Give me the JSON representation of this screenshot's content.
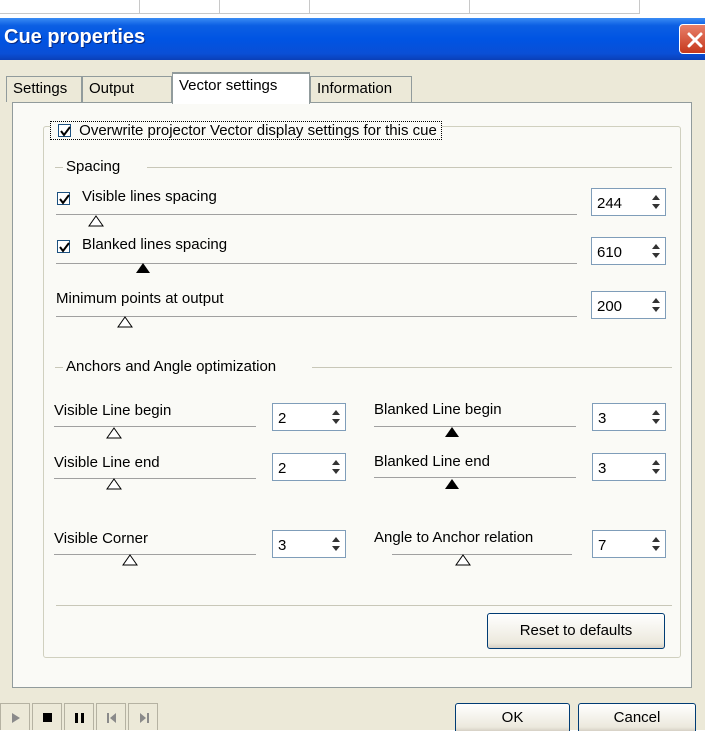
{
  "window": {
    "title": "Cue properties"
  },
  "tabs": [
    {
      "label": "Settings",
      "active": false
    },
    {
      "label": "Output",
      "active": false
    },
    {
      "label": "Vector settings",
      "active": true
    },
    {
      "label": "Information",
      "active": false
    }
  ],
  "overwrite": {
    "label": "Overwrite projector Vector display settings for this cue",
    "checked": true
  },
  "spacing": {
    "section_label": "Spacing",
    "visible_lines": {
      "label": "Visible lines spacing",
      "checked": true,
      "value": "244"
    },
    "blanked_lines": {
      "label": "Blanked lines spacing",
      "checked": true,
      "value": "610"
    },
    "min_points": {
      "label": "Minimum points at output",
      "value": "200"
    }
  },
  "anchors": {
    "section_label": "Anchors and Angle optimization",
    "visible_line_begin": {
      "label": "Visible Line begin",
      "value": "2"
    },
    "blanked_line_begin": {
      "label": "Blanked Line begin",
      "value": "3"
    },
    "visible_line_end": {
      "label": "Visible Line end",
      "value": "2"
    },
    "blanked_line_end": {
      "label": "Blanked Line end",
      "value": "3"
    },
    "visible_corner": {
      "label": "Visible Corner",
      "value": "3"
    },
    "angle_anchor": {
      "label": "Angle to Anchor relation",
      "value": "7"
    }
  },
  "buttons": {
    "reset": "Reset to defaults",
    "ok": "OK",
    "cancel": "Cancel"
  },
  "transport": [
    "play-icon",
    "stop-icon",
    "pause-icon",
    "skip-back-icon",
    "skip-forward-icon"
  ],
  "colors": {
    "titlebar": "#0054e3",
    "dialog_bg": "#ece9d8",
    "panel_bg": "#fafaf6",
    "close_button": "#c6381c"
  }
}
